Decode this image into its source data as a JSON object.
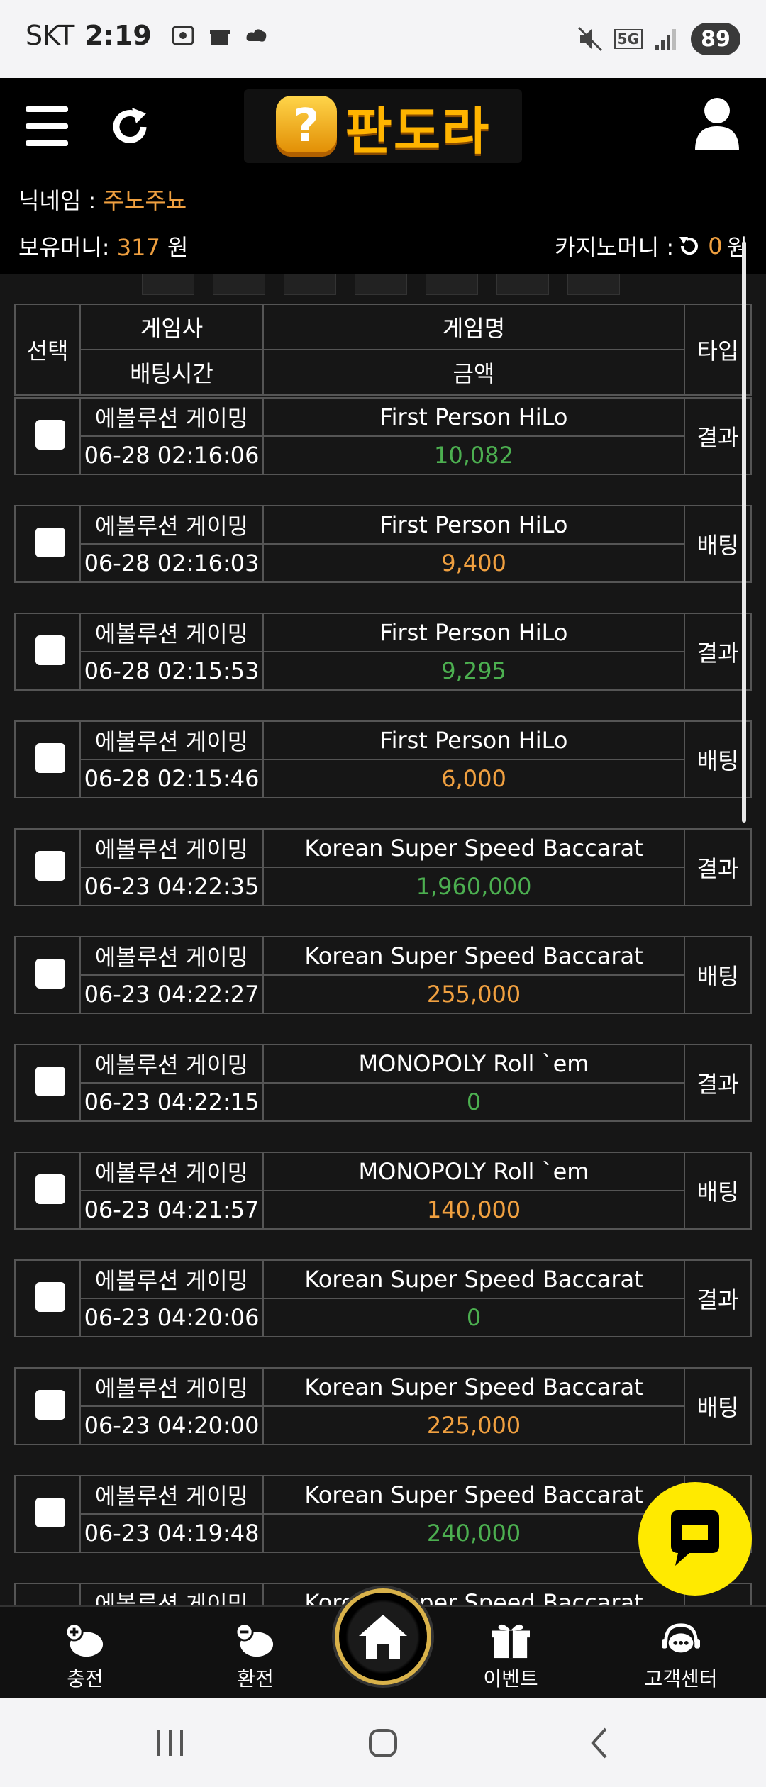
{
  "status_bar": {
    "carrier": "SKT",
    "time": "2:19",
    "battery": "89",
    "network": "5G"
  },
  "header": {
    "logo_text": "판도라",
    "logo_badge": "?",
    "nickname_label": "닉네임 : ",
    "nickname_value": "주노주뇨",
    "money_label": "보유머니: ",
    "money_value": "317",
    "money_unit": " 원",
    "casino_label": "카지노머니 : ",
    "casino_value": "0",
    "casino_unit": "원"
  },
  "table": {
    "headers": {
      "select": "선택",
      "company": "게임사",
      "game": "게임명",
      "type": "타입",
      "time": "배팅시간",
      "amount": "금액"
    },
    "rows": [
      {
        "company": "에볼루션 게이밍",
        "game": "First Person HiLo",
        "time": "06-28 02:16:06",
        "amount": "10,082",
        "type": "결과",
        "color": "green"
      },
      {
        "company": "에볼루션 게이밍",
        "game": "First Person HiLo",
        "time": "06-28 02:16:03",
        "amount": "9,400",
        "type": "배팅",
        "color": "orange"
      },
      {
        "company": "에볼루션 게이밍",
        "game": "First Person HiLo",
        "time": "06-28 02:15:53",
        "amount": "9,295",
        "type": "결과",
        "color": "green"
      },
      {
        "company": "에볼루션 게이밍",
        "game": "First Person HiLo",
        "time": "06-28 02:15:46",
        "amount": "6,000",
        "type": "배팅",
        "color": "orange"
      },
      {
        "company": "에볼루션 게이밍",
        "game": "Korean Super Speed Baccarat",
        "time": "06-23 04:22:35",
        "amount": "1,960,000",
        "type": "결과",
        "color": "green"
      },
      {
        "company": "에볼루션 게이밍",
        "game": "Korean Super Speed Baccarat",
        "time": "06-23 04:22:27",
        "amount": "255,000",
        "type": "배팅",
        "color": "orange"
      },
      {
        "company": "에볼루션 게이밍",
        "game": "MONOPOLY Roll `em",
        "time": "06-23 04:22:15",
        "amount": "0",
        "type": "결과",
        "color": "green"
      },
      {
        "company": "에볼루션 게이밍",
        "game": "MONOPOLY Roll `em",
        "time": "06-23 04:21:57",
        "amount": "140,000",
        "type": "배팅",
        "color": "orange"
      },
      {
        "company": "에볼루션 게이밍",
        "game": "Korean Super Speed Baccarat",
        "time": "06-23 04:20:06",
        "amount": "0",
        "type": "결과",
        "color": "green"
      },
      {
        "company": "에볼루션 게이밍",
        "game": "Korean Super Speed Baccarat",
        "time": "06-23 04:20:00",
        "amount": "225,000",
        "type": "배팅",
        "color": "orange"
      },
      {
        "company": "에볼루션 게이밍",
        "game": "Korean Super Speed Baccarat",
        "time": "06-23 04:19:48",
        "amount": "240,000",
        "type": "",
        "color": "green"
      },
      {
        "company": "에볼루션 게이밍",
        "game": "Korean Super Speed Baccarat",
        "time": "",
        "amount": "",
        "type": "",
        "color": "green"
      }
    ]
  },
  "bottom_nav": {
    "charge": "충전",
    "exchange": "환전",
    "event": "이벤트",
    "support": "고객센터"
  },
  "colors": {
    "accent_orange": "#f0a040",
    "result_green": "#4caf50",
    "chat_yellow": "#ffea00"
  },
  "icons": {
    "menu": "hamburger-icon",
    "refresh": "refresh-icon",
    "user": "user-icon",
    "chat": "chat-icon",
    "home": "home-icon"
  }
}
